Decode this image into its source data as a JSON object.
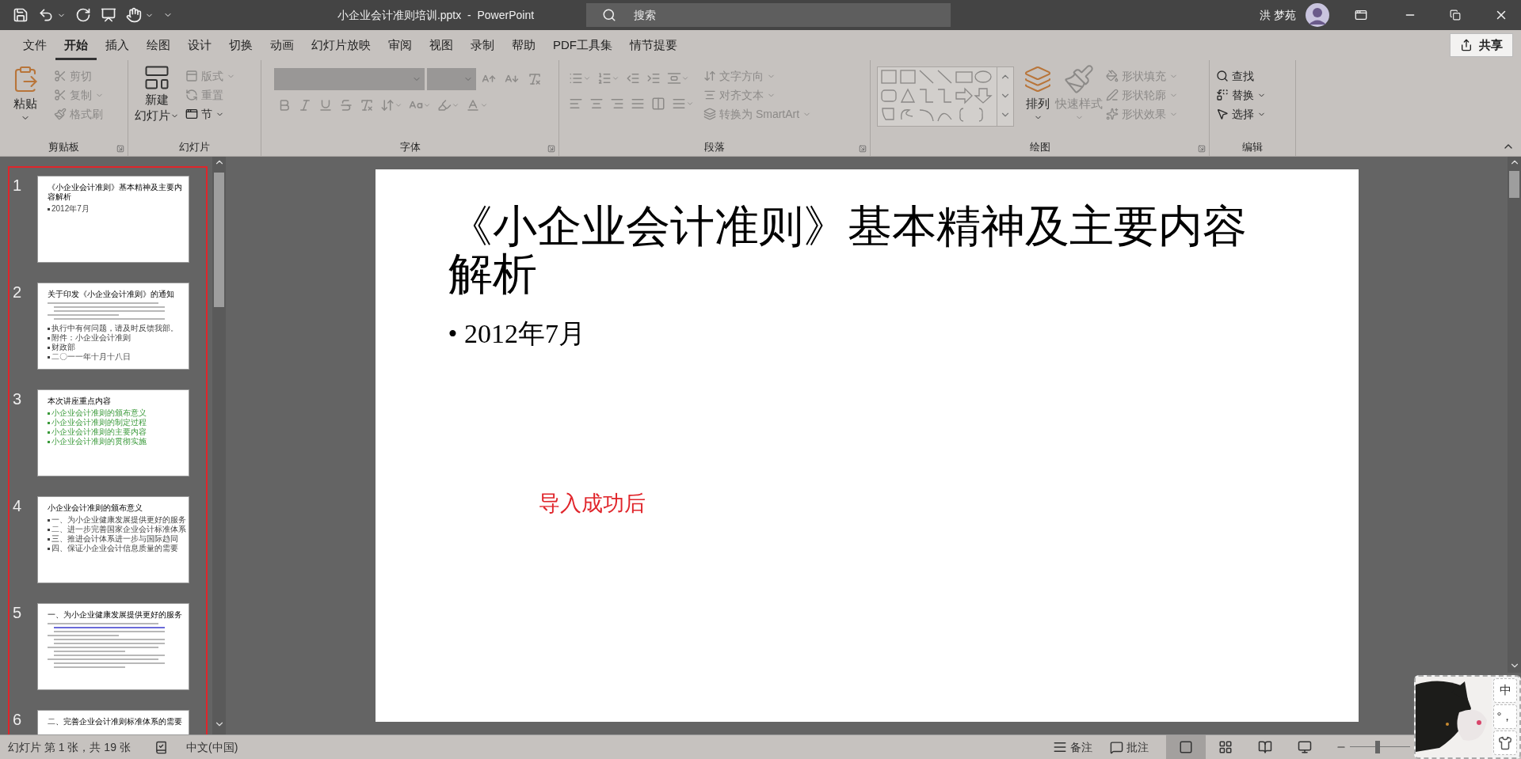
{
  "window": {
    "title": "小企业会计准则培训.pptx  -  PowerPoint",
    "user": "洪 梦苑"
  },
  "search": {
    "placeholder": "搜索"
  },
  "tabs": [
    {
      "label": "文件",
      "selected": false
    },
    {
      "label": "开始",
      "selected": true
    },
    {
      "label": "插入",
      "selected": false
    },
    {
      "label": "绘图",
      "selected": false
    },
    {
      "label": "设计",
      "selected": false
    },
    {
      "label": "切换",
      "selected": false
    },
    {
      "label": "动画",
      "selected": false
    },
    {
      "label": "幻灯片放映",
      "selected": false
    },
    {
      "label": "审阅",
      "selected": false
    },
    {
      "label": "视图",
      "selected": false
    },
    {
      "label": "录制",
      "selected": false
    },
    {
      "label": "帮助",
      "selected": false
    },
    {
      "label": "PDF工具集",
      "selected": false
    },
    {
      "label": "情节提要",
      "selected": false
    }
  ],
  "share_button": "共享",
  "ribbon": {
    "groups": [
      {
        "label": "剪贴板",
        "items": [
          {
            "label": "粘贴",
            "disabled": false
          },
          {
            "label": "剪切",
            "disabled": true
          },
          {
            "label": "复制",
            "disabled": true
          },
          {
            "label": "格式刷",
            "disabled": true
          }
        ]
      },
      {
        "label": "幻灯片",
        "items": [
          {
            "lines": [
              "新建",
              "幻灯片"
            ],
            "disabled": false
          },
          {
            "label": "版式",
            "disabled": true
          },
          {
            "label": "重置",
            "disabled": true
          },
          {
            "label": "节",
            "disabled": false
          }
        ]
      },
      {
        "label": "字体",
        "disabled": true
      },
      {
        "label": "段落",
        "disabled": true,
        "items": [
          {
            "label": "文字方向",
            "disabled": true
          },
          {
            "label": "对齐文本",
            "disabled": true
          },
          {
            "label": "转换为 SmartArt",
            "disabled": true
          }
        ]
      },
      {
        "label": "绘图",
        "items": [
          {
            "label": "排列",
            "disabled": false
          },
          {
            "label": "快速样式",
            "disabled": true
          },
          {
            "label": "形状填充",
            "disabled": true
          },
          {
            "label": "形状轮廓",
            "disabled": true
          },
          {
            "label": "形状效果",
            "disabled": true
          }
        ]
      },
      {
        "label": "编辑",
        "items": [
          {
            "label": "查找",
            "disabled": false
          },
          {
            "label": "替换",
            "disabled": false
          },
          {
            "label": "选择",
            "disabled": false
          }
        ]
      }
    ]
  },
  "thumbnails": [
    {
      "number": "1",
      "kind": "plain",
      "title": "《小企业会计准则》基本精神及主要内容解析",
      "bullets": [
        {
          "text": "2012年7月",
          "color": "#444444"
        }
      ]
    },
    {
      "number": "2",
      "kind": "dense",
      "title": "关于印发《小企业会计准则》的通知",
      "bullets": [
        {
          "text": "执行中有何问题，请及时反馈我部。",
          "color": "#444444"
        },
        {
          "text": "附件：小企业会计准则",
          "color": "#444444"
        },
        {
          "text": "财政部",
          "color": "#444444"
        },
        {
          "text": "二〇一一年十月十八日",
          "color": "#444444"
        }
      ]
    },
    {
      "number": "3",
      "kind": "plain",
      "title": "本次讲座重点内容",
      "bullets": [
        {
          "text": "小企业会计准则的颁布意义",
          "color": "#3a9a3a"
        },
        {
          "text": "小企业会计准则的制定过程",
          "color": "#3a9a3a"
        },
        {
          "text": "小企业会计准则的主要内容",
          "color": "#3a9a3a"
        },
        {
          "text": "小企业会计准则的贯彻实施",
          "color": "#3a9a3a"
        }
      ]
    },
    {
      "number": "4",
      "kind": "plain",
      "title": "小企业会计准则的颁布意义",
      "bullets": [
        {
          "text": "一、为小企业健康发展提供更好的服务",
          "color": "#444444"
        },
        {
          "text": "二、进一步完善国家企业会计标准体系",
          "color": "#444444"
        },
        {
          "text": "三、推进会计体系进一步与国际趋同",
          "color": "#444444"
        },
        {
          "text": "四、保证小企业会计信息质量的需要",
          "color": "#444444"
        }
      ]
    },
    {
      "number": "5",
      "kind": "dense",
      "title": "一、为小企业健康发展提供更好的服务"
    },
    {
      "number": "6",
      "kind": "plain",
      "title": "二、完善企业会计准则标准体系的需要"
    }
  ],
  "slide": {
    "title": "《小企业会计准则》基本精神及主要内容解析",
    "bullets": [
      "• 2012年7月"
    ]
  },
  "annotation": "导入成功后",
  "status_bar": {
    "slide_info": "幻灯片 第 1 张，共 19 张",
    "language": "中文(中国)",
    "notes": "备注",
    "comments": "批注",
    "views": [
      {
        "selected": true
      },
      {
        "selected": false
      },
      {
        "selected": false
      },
      {
        "selected": false
      }
    ],
    "zoom": {
      "level": 0.45
    }
  },
  "ime": {
    "keys": [
      "中",
      "°，"
    ]
  }
}
